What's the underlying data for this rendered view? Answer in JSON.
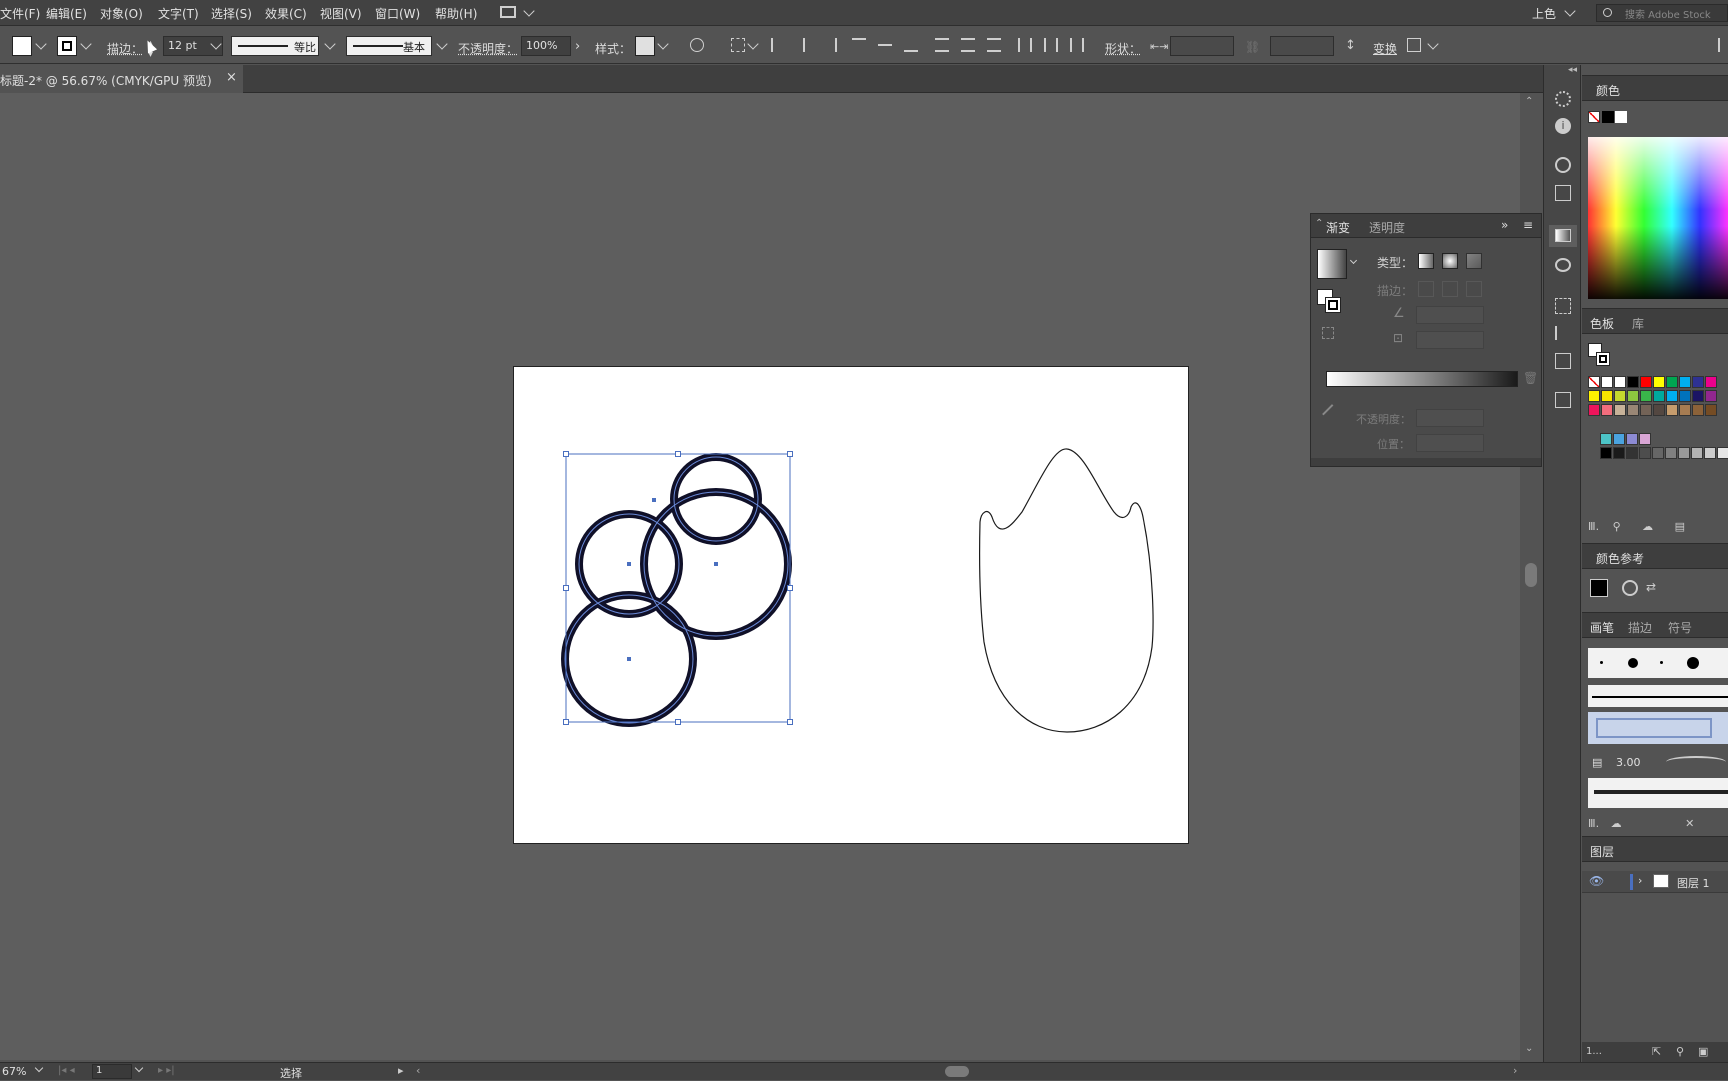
{
  "menu": {
    "items": [
      "文件(F)",
      "编辑(E)",
      "对象(O)",
      "文字(T)",
      "选择(S)",
      "效果(C)",
      "视图(V)",
      "窗口(W)",
      "帮助(H)"
    ],
    "workspace": "上色",
    "search_placeholder": "搜索 Adobe Stock"
  },
  "control": {
    "stroke_label": "描边：",
    "stroke_value": "12 pt",
    "profile_label": "等比",
    "brush_label": "基本",
    "opacity_label": "不透明度：",
    "opacity_value": "100%",
    "style_label": "样式：",
    "shape_label": "形状：",
    "transform_label": "变换"
  },
  "document": {
    "tab_title": "标题-2* @ 56.67% (CMYK/GPU 预览)",
    "close": "×"
  },
  "gradient_panel": {
    "tab_active": "渐变",
    "tab_inactive": "透明度",
    "type_label": "类型：",
    "stroke_label": "描边：",
    "opacity_label": "不透明度：",
    "position_label": "位置："
  },
  "right_panels": {
    "color": {
      "title": "颜色"
    },
    "swatches": {
      "tab_active": "色板",
      "tab_inactive": "库"
    },
    "color_guide": {
      "title": "颜色参考"
    },
    "brushes": {
      "tab_active": "画笔",
      "tab_2": "描边",
      "tab_3": "符号",
      "brush_size": "3.00"
    },
    "layers": {
      "title": "图层",
      "layer_name": "图层 1",
      "footer": "1..."
    }
  },
  "status": {
    "zoom": "67%",
    "page": "1",
    "tool": "选择"
  },
  "colors": {
    "ui_dark": "#424242",
    "canvas": "#5e5e5e",
    "selection": "#4a6fbf",
    "stroke": "#141428"
  }
}
